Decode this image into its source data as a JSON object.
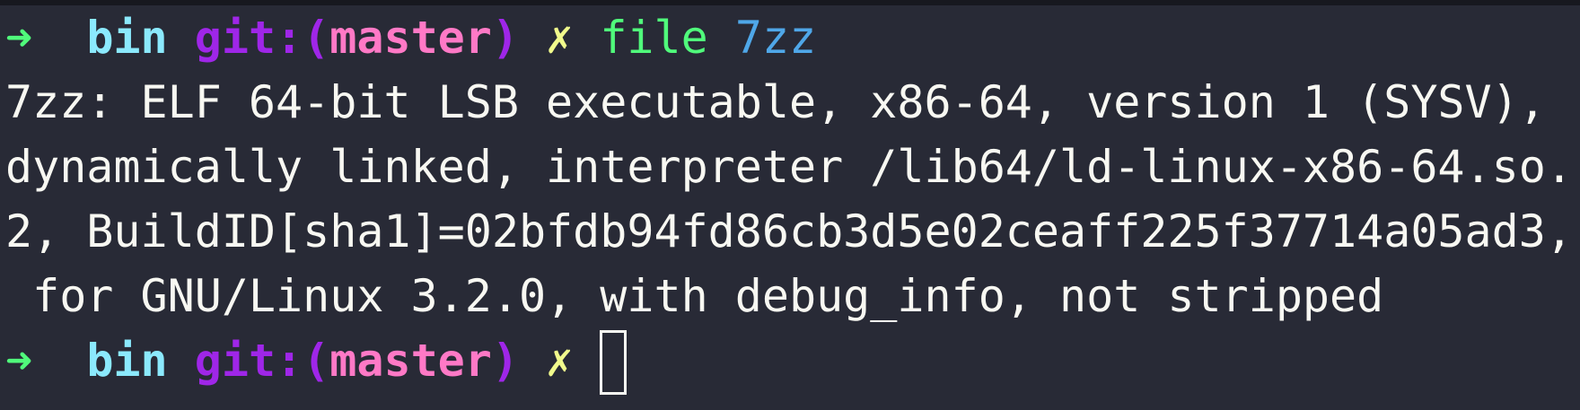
{
  "prompt": {
    "arrow": "➜",
    "directory": "bin",
    "git_label": "git:(",
    "branch": "master",
    "git_close": ")",
    "dirty_marker": "✗"
  },
  "command": {
    "name": "file",
    "argument": "7zz"
  },
  "output_lines": [
    "7zz: ELF 64-bit LSB executable, x86-64, version 1 (SYSV),",
    "dynamically linked, interpreter /lib64/ld-linux-x86-64.so.",
    "2, BuildID[sha1]=02bfdb94fd86cb3d5e02ceaff225f37714a05ad3,",
    " for GNU/Linux 3.2.0, with debug_info, not stripped"
  ],
  "colors": {
    "background": "#282a36",
    "arrow": "#50fa7b",
    "directory": "#8be9fd",
    "git": "#9f26e8",
    "branch": "#ff79c6",
    "dirty": "#f1fa8c",
    "command": "#50fa7b",
    "argument": "#4fa7e8",
    "text": "#f8f8f2"
  }
}
